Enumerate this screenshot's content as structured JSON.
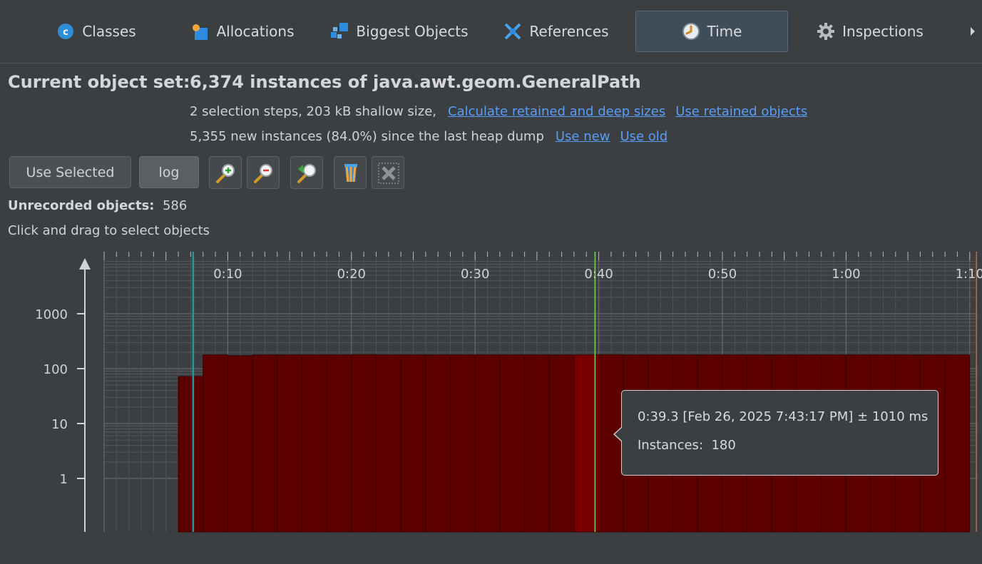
{
  "tabs": [
    {
      "label": "Classes",
      "icon": "classes-icon"
    },
    {
      "label": "Allocations",
      "icon": "allocations-icon"
    },
    {
      "label": "Biggest Objects",
      "icon": "biggest-objects-icon"
    },
    {
      "label": "References",
      "icon": "references-icon"
    },
    {
      "label": "Time",
      "icon": "clock-icon",
      "active": true
    },
    {
      "label": "Inspections",
      "icon": "gear-icon"
    }
  ],
  "header": {
    "label": "Current object set:",
    "value": "6,374 instances of java.awt.geom.GeneralPath",
    "line1_text": "2 selection steps, 203 kB shallow size,",
    "line1_link1": "Calculate retained and deep sizes",
    "line1_link2": "Use retained objects",
    "line2_text": "5,355 new instances (84.0%) since the last heap dump",
    "line2_link1": "Use new",
    "line2_link2": "Use old"
  },
  "toolbar": {
    "use_selected_label": "Use Selected",
    "log_label": "log",
    "icons": [
      "zoom-in-icon",
      "zoom-out-icon",
      "zoom-reset-icon",
      "clear-selection-icon",
      "remove-icon"
    ]
  },
  "info": {
    "unrecorded_label": "Unrecorded objects:",
    "unrecorded_value": "586",
    "hint": "Click and drag to select objects"
  },
  "tooltip": {
    "line1": "0:39.3 [Feb 26, 2025 7:43:17 PM] ± 1010 ms",
    "instances_label": "Instances:",
    "instances_value": "180"
  },
  "colors": {
    "background": "#3c3f41",
    "bar": "#5c0000",
    "bar_highlight": "#7a0000",
    "bar_outline": "#3a0000",
    "cyan_marker": "#1e9aa0",
    "green_marker": "#7cd35c",
    "link": "#589df6",
    "orange_edge": "#c86a2a"
  },
  "chart_data": {
    "type": "bar",
    "yscale": "log",
    "xlabel": "",
    "ylabel": "",
    "x_tick_labels": [
      "0:10",
      "0:20",
      "0:30",
      "0:40",
      "0:50",
      "1:00",
      "1:10"
    ],
    "x_ticks_seconds": [
      10,
      20,
      30,
      40,
      50,
      60,
      70
    ],
    "y_tick_labels": [
      "1000",
      "100",
      "10",
      "1"
    ],
    "y_ticks": [
      1000,
      100,
      10,
      1
    ],
    "xlim_seconds": [
      0,
      70.6
    ],
    "ylim": [
      0.1,
      10000
    ],
    "bin_seconds": 2,
    "bars_start_x": [
      6,
      8,
      10,
      12,
      14,
      16,
      18,
      20,
      22,
      24,
      26,
      28,
      30,
      32,
      34,
      36,
      38,
      40,
      42,
      44,
      46,
      48,
      50,
      52,
      54,
      56,
      58,
      60,
      62,
      64,
      66,
      68
    ],
    "values": [
      72,
      178,
      172,
      178,
      178,
      178,
      178,
      180,
      178,
      178,
      178,
      178,
      178,
      178,
      178,
      178,
      178,
      180,
      178,
      178,
      178,
      178,
      178,
      178,
      178,
      178,
      178,
      178,
      178,
      178,
      178,
      178
    ],
    "highlight_bar_start": 38,
    "markers": [
      {
        "x": 7.2,
        "color": "#1e9aa0"
      },
      {
        "x": 39.7,
        "color": "#7cd35c"
      }
    ],
    "grid": true
  }
}
